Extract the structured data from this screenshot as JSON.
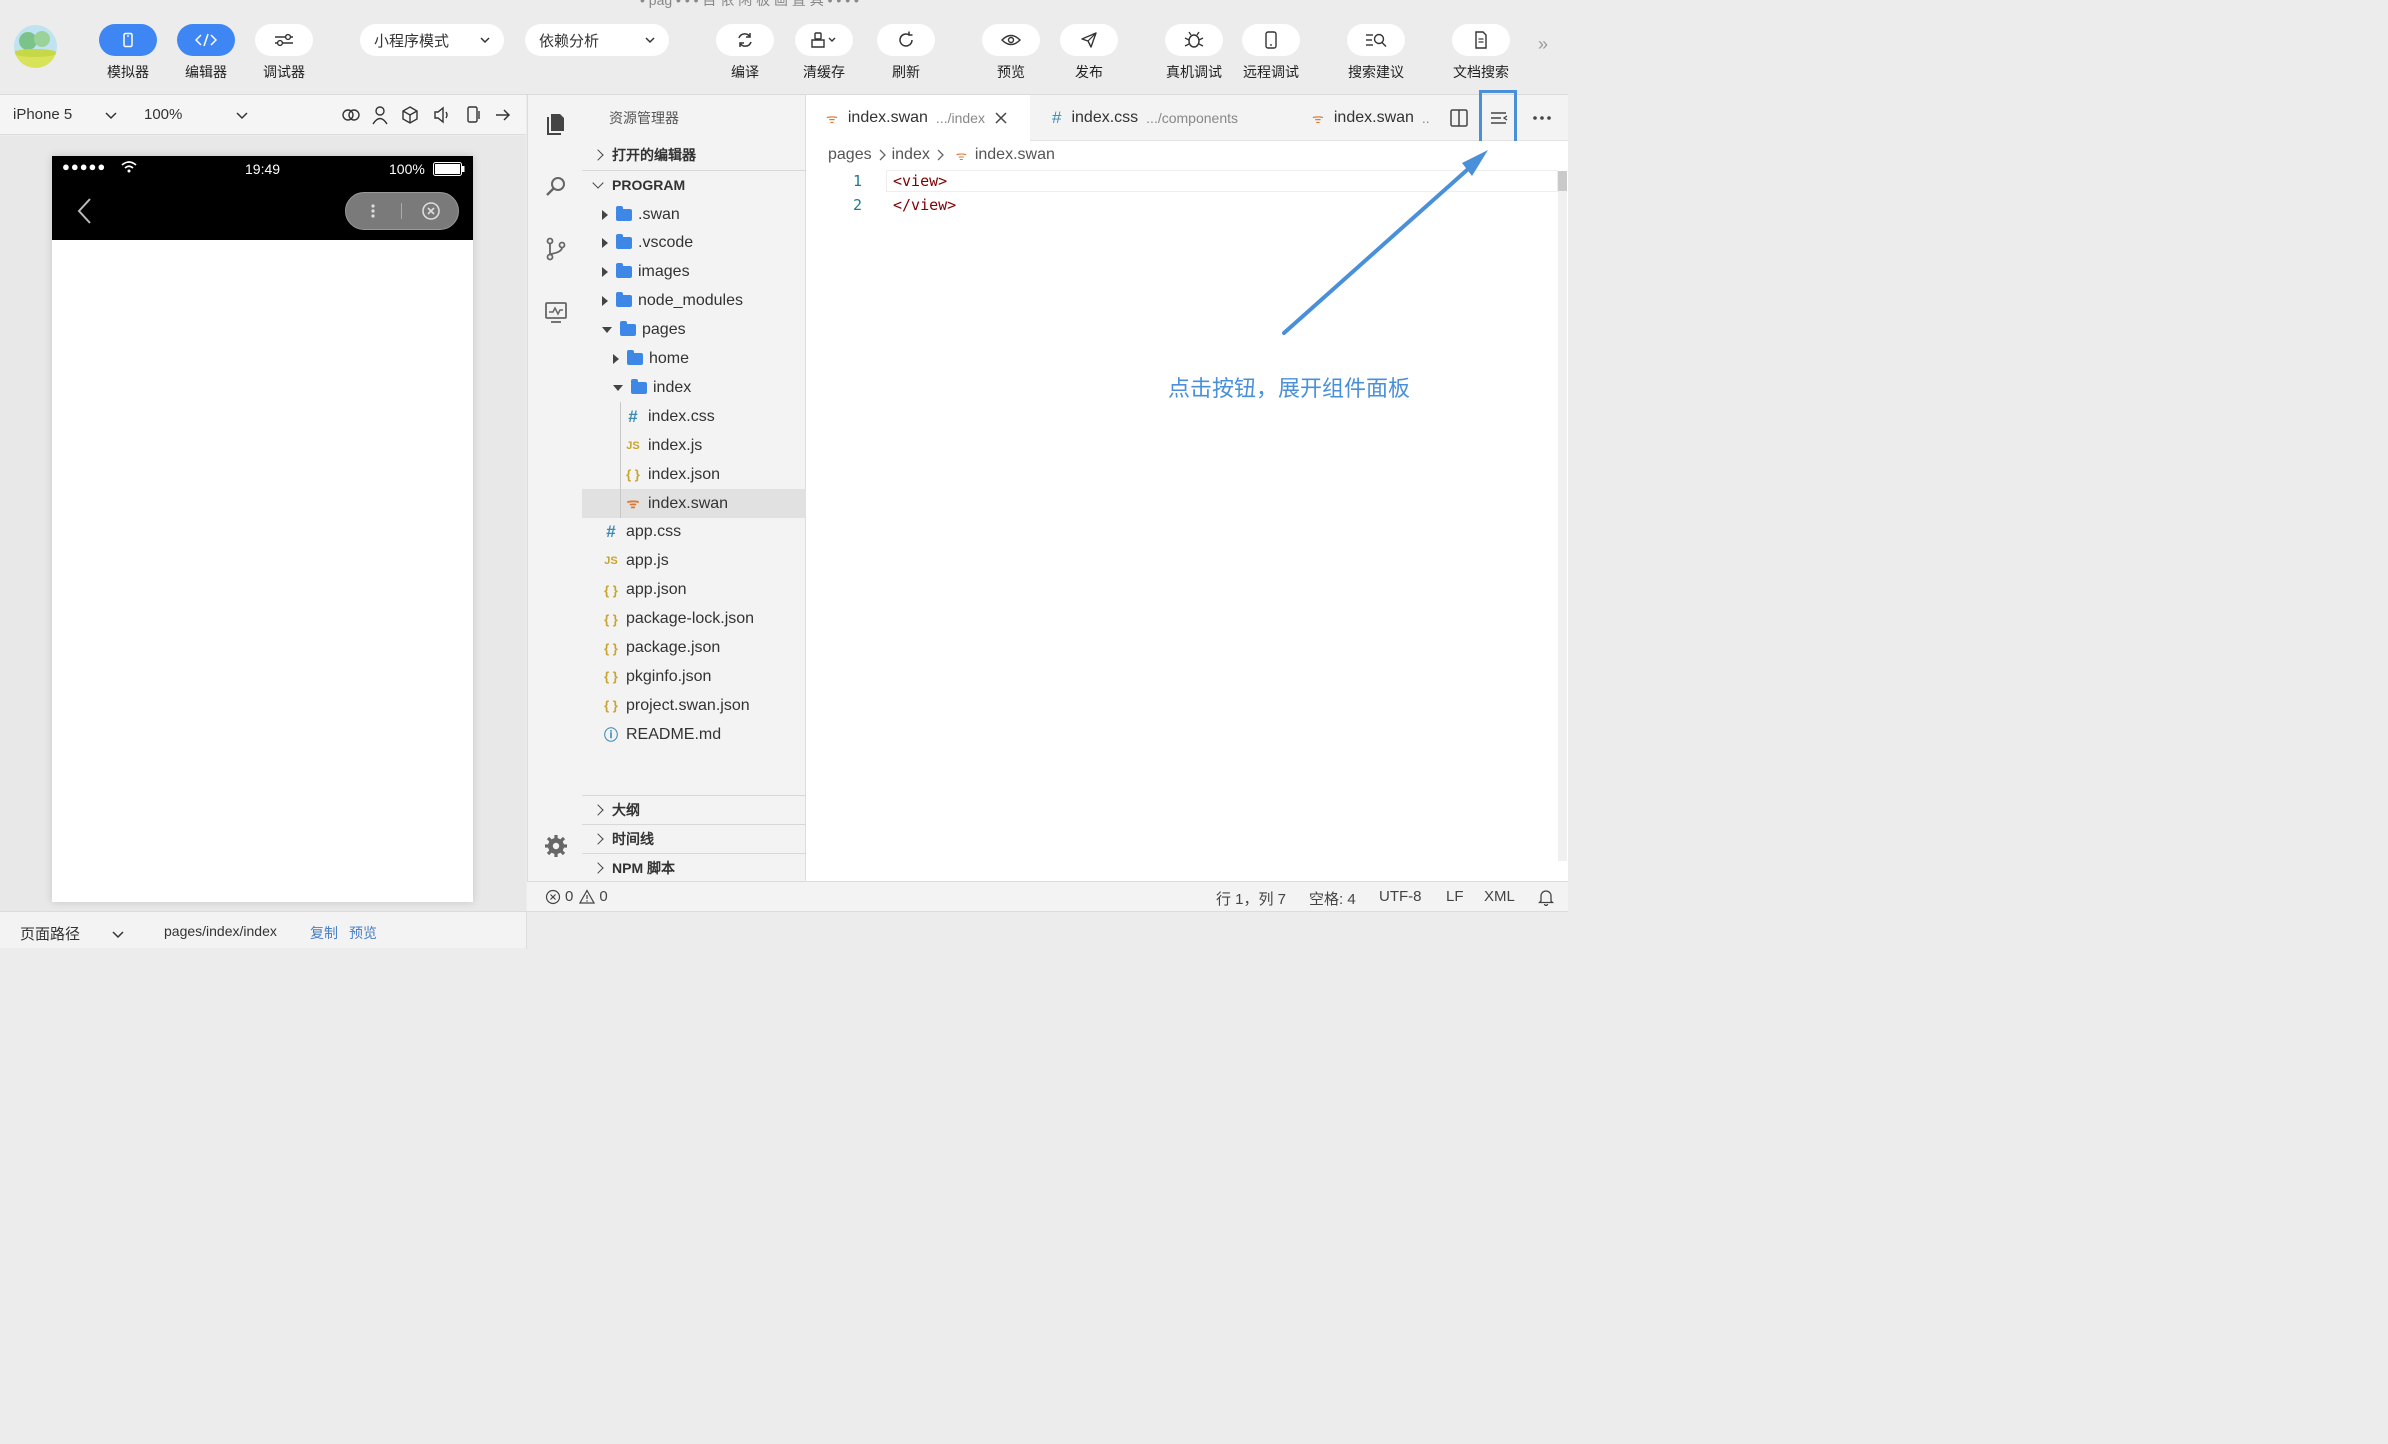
{
  "toolbar": {
    "window_title": "• pag • • • 目 侬 闲 板 画 置 具 • • • •",
    "buttons": [
      {
        "label": "模拟器",
        "icon": "phone-icon",
        "active": true
      },
      {
        "label": "编辑器",
        "icon": "code-icon",
        "active": true
      },
      {
        "label": "调试器",
        "icon": "toggle-icon",
        "active": false
      },
      {
        "label": "编译",
        "icon": "refresh-arrows-icon"
      },
      {
        "label": "清缓存",
        "icon": "broom-icon"
      },
      {
        "label": "刷新",
        "icon": "reload-icon"
      },
      {
        "label": "预览",
        "icon": "eye-icon"
      },
      {
        "label": "发布",
        "icon": "paper-plane-icon"
      },
      {
        "label": "真机调试",
        "icon": "bug-icon"
      },
      {
        "label": "远程调试",
        "icon": "mobile-icon"
      },
      {
        "label": "搜索建议",
        "icon": "search-list-icon"
      },
      {
        "label": "文档搜索",
        "icon": "document-icon"
      }
    ],
    "mode_select": "小程序模式",
    "dependency_select": "依赖分析",
    "overflow": "»"
  },
  "simulator": {
    "device": "iPhone 5",
    "zoom": "100%",
    "status_time": "19:49",
    "status_battery": "100%",
    "status_signal": "●●●●●"
  },
  "explorer": {
    "title": "资源管理器",
    "open_editors": "打开的编辑器",
    "root": "PROGRAM",
    "tree": [
      {
        "label": ".swan",
        "type": "folder",
        "depth": 1,
        "open": false
      },
      {
        "label": ".vscode",
        "type": "folder",
        "depth": 1,
        "open": false
      },
      {
        "label": "images",
        "type": "folder",
        "depth": 1,
        "open": false
      },
      {
        "label": "node_modules",
        "type": "folder",
        "depth": 1,
        "open": false
      },
      {
        "label": "pages",
        "type": "folder",
        "depth": 1,
        "open": true
      },
      {
        "label": "home",
        "type": "folder",
        "depth": 2,
        "open": false
      },
      {
        "label": "index",
        "type": "folder",
        "depth": 2,
        "open": true
      },
      {
        "label": "index.css",
        "type": "css",
        "depth": 3
      },
      {
        "label": "index.js",
        "type": "js",
        "depth": 3
      },
      {
        "label": "index.json",
        "type": "json",
        "depth": 3
      },
      {
        "label": "index.swan",
        "type": "swan",
        "depth": 3,
        "selected": true
      },
      {
        "label": "app.css",
        "type": "css",
        "depth": 1
      },
      {
        "label": "app.js",
        "type": "js",
        "depth": 1
      },
      {
        "label": "app.json",
        "type": "json",
        "depth": 1
      },
      {
        "label": "package-lock.json",
        "type": "json",
        "depth": 1
      },
      {
        "label": "package.json",
        "type": "json",
        "depth": 1
      },
      {
        "label": "pkginfo.json",
        "type": "json",
        "depth": 1
      },
      {
        "label": "project.swan.json",
        "type": "json",
        "depth": 1
      },
      {
        "label": "README.md",
        "type": "info",
        "depth": 1
      }
    ],
    "sections": [
      "大纲",
      "时间线",
      "NPM 脚本"
    ]
  },
  "editor": {
    "tabs": [
      {
        "name": "index.swan",
        "sub": ".../index",
        "icon": "swan-file-icon",
        "active": true
      },
      {
        "name": "index.css",
        "sub": ".../components",
        "icon": "css-file-icon",
        "active": false
      },
      {
        "name": "index.swan",
        "sub": "..",
        "icon": "swan-file-icon",
        "active": false
      }
    ],
    "breadcrumb": [
      "pages",
      "index",
      "index.swan"
    ],
    "lines": [
      {
        "num": "1",
        "text": "<view>"
      },
      {
        "num": "2",
        "text": "</view>"
      }
    ],
    "annotation": "点击按钮，展开组件面板"
  },
  "status": {
    "errors": "0",
    "warnings": "0",
    "position": "行 1，列 7",
    "indent": "空格: 4",
    "encoding": "UTF-8",
    "eol": "LF",
    "language": "XML"
  },
  "bottom": {
    "path_label": "页面路径",
    "path": "pages/index/index",
    "copy": "复制",
    "preview": "预览"
  },
  "colors": {
    "accent": "#3f86f5",
    "annotation": "#4a90d9"
  }
}
